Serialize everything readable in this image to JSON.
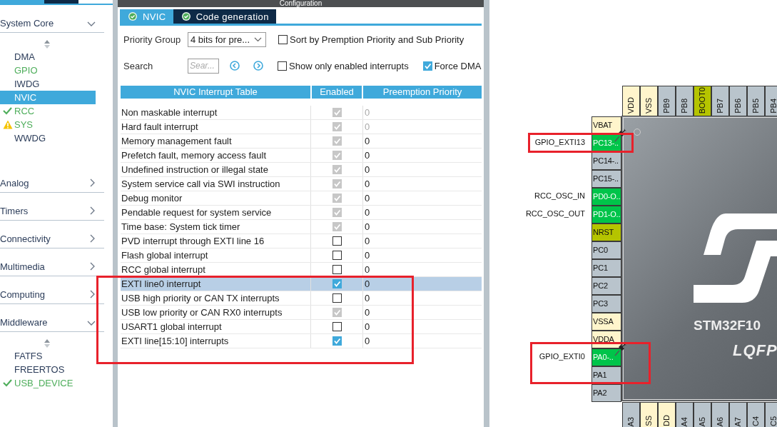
{
  "sidebar": {
    "top_tabs": [
      {
        "selected": true
      },
      {
        "selected": false
      }
    ],
    "categories": [
      {
        "label": "System Core",
        "expanded": true,
        "items": [
          {
            "label": "DMA",
            "kind": "plain",
            "selected": false
          },
          {
            "label": "GPIO",
            "kind": "configured",
            "selected": false
          },
          {
            "label": "IWDG",
            "kind": "plain",
            "selected": false
          },
          {
            "label": "NVIC",
            "kind": "plain",
            "selected": true
          },
          {
            "label": "RCC",
            "kind": "ok",
            "selected": false
          },
          {
            "label": "SYS",
            "kind": "warning",
            "selected": false
          },
          {
            "label": "WWDG",
            "kind": "plain",
            "selected": false
          }
        ]
      },
      {
        "label": "Analog",
        "expanded": false
      },
      {
        "label": "Timers",
        "expanded": false
      },
      {
        "label": "Connectivity",
        "expanded": false
      },
      {
        "label": "Multimedia",
        "expanded": false
      },
      {
        "label": "Computing",
        "expanded": false
      },
      {
        "label": "Middleware",
        "expanded": true,
        "items": [
          {
            "label": "FATFS",
            "kind": "plain",
            "selected": false
          },
          {
            "label": "FREERTOS",
            "kind": "plain",
            "selected": false
          },
          {
            "label": "USB_DEVICE",
            "kind": "ok",
            "selected": false
          }
        ]
      }
    ]
  },
  "panel": {
    "title": "Configuration",
    "tabs": [
      {
        "label": "NVIC",
        "selected": true
      },
      {
        "label": "Code generation",
        "selected": false
      }
    ],
    "priority_group": {
      "label": "Priority Group",
      "value": "4 bits for pre..."
    },
    "sort_option": {
      "label": "Sort by Premption Priority and Sub Priority",
      "checked": false
    },
    "search": {
      "label": "Search",
      "placeholder": "Sear..."
    },
    "show_enabled_option": {
      "label": "Show only enabled interrupts",
      "checked": false
    },
    "force_dma_option": {
      "label": "Force DMA",
      "checked": true
    },
    "table": {
      "columns": [
        "NVIC Interrupt Table",
        "Enabled",
        "Preemption Priority"
      ],
      "rows": [
        {
          "name": "Non maskable interrupt",
          "enabled": true,
          "editable": false,
          "priority": "0",
          "priority_editable": false,
          "selected": false
        },
        {
          "name": "Hard fault interrupt",
          "enabled": true,
          "editable": false,
          "priority": "0",
          "priority_editable": false,
          "selected": false
        },
        {
          "name": "Memory management fault",
          "enabled": true,
          "editable": false,
          "priority": "0",
          "priority_editable": true,
          "selected": false
        },
        {
          "name": "Prefetch fault, memory access fault",
          "enabled": true,
          "editable": false,
          "priority": "0",
          "priority_editable": true,
          "selected": false
        },
        {
          "name": "Undefined instruction or illegal state",
          "enabled": true,
          "editable": false,
          "priority": "0",
          "priority_editable": true,
          "selected": false
        },
        {
          "name": "System service call via SWI instruction",
          "enabled": true,
          "editable": false,
          "priority": "0",
          "priority_editable": true,
          "selected": false
        },
        {
          "name": "Debug monitor",
          "enabled": true,
          "editable": false,
          "priority": "0",
          "priority_editable": true,
          "selected": false
        },
        {
          "name": "Pendable request for system service",
          "enabled": true,
          "editable": false,
          "priority": "0",
          "priority_editable": true,
          "selected": false
        },
        {
          "name": "Time base: System tick timer",
          "enabled": true,
          "editable": false,
          "priority": "0",
          "priority_editable": true,
          "selected": false
        },
        {
          "name": "PVD interrupt through EXTI line 16",
          "enabled": false,
          "editable": true,
          "priority": "0",
          "priority_editable": true,
          "selected": false
        },
        {
          "name": "Flash global interrupt",
          "enabled": false,
          "editable": true,
          "priority": "0",
          "priority_editable": true,
          "selected": false
        },
        {
          "name": "RCC global interrupt",
          "enabled": false,
          "editable": true,
          "priority": "0",
          "priority_editable": true,
          "selected": false
        },
        {
          "name": "EXTI line0 interrupt",
          "enabled": true,
          "editable": true,
          "priority": "0",
          "priority_editable": true,
          "selected": true
        },
        {
          "name": "USB high priority or CAN TX interrupts",
          "enabled": false,
          "editable": true,
          "priority": "0",
          "priority_editable": true,
          "selected": false
        },
        {
          "name": "USB low priority or CAN RX0 interrupts",
          "enabled": true,
          "editable": false,
          "priority": "0",
          "priority_editable": true,
          "selected": false
        },
        {
          "name": "USART1 global interrupt",
          "enabled": false,
          "editable": true,
          "priority": "0",
          "priority_editable": true,
          "selected": false
        },
        {
          "name": "EXTI line[15:10] interrupts",
          "enabled": true,
          "editable": true,
          "priority": "0",
          "priority_editable": true,
          "selected": false
        }
      ]
    }
  },
  "chip": {
    "name": "STM32F10",
    "package": "LQFP",
    "top_pins": [
      {
        "label": "VDD",
        "kind": "power"
      },
      {
        "label": "VSS",
        "kind": "power"
      },
      {
        "label": "PB9",
        "kind": "io"
      },
      {
        "label": "PB8",
        "kind": "io"
      },
      {
        "label": "BOOT0",
        "kind": "special"
      },
      {
        "label": "PB7",
        "kind": "io"
      },
      {
        "label": "PB6",
        "kind": "io"
      },
      {
        "label": "PB5",
        "kind": "io"
      },
      {
        "label": "PB4",
        "kind": "io"
      }
    ],
    "left_pins": [
      {
        "label": "VBAT",
        "kind": "power",
        "pinned": false
      },
      {
        "label": "PC13-..",
        "kind": "assigned",
        "signal": "GPIO_EXTI13",
        "pinned": true
      },
      {
        "label": "PC14-..",
        "kind": "io",
        "pinned": false
      },
      {
        "label": "PC15-..",
        "kind": "io",
        "pinned": false
      },
      {
        "label": "PD0-O..",
        "kind": "assigned",
        "signal": "RCC_OSC_IN",
        "pinned": false
      },
      {
        "label": "PD1-O..",
        "kind": "assigned",
        "signal": "RCC_OSC_OUT",
        "pinned": false
      },
      {
        "label": "NRST",
        "kind": "special",
        "pinned": false
      },
      {
        "label": "PC0",
        "kind": "io",
        "pinned": false
      },
      {
        "label": "PC1",
        "kind": "io",
        "pinned": false
      },
      {
        "label": "PC2",
        "kind": "io",
        "pinned": false
      },
      {
        "label": "PC3",
        "kind": "io",
        "pinned": false
      },
      {
        "label": "VSSA",
        "kind": "power",
        "pinned": false
      },
      {
        "label": "VDDA",
        "kind": "power",
        "pinned": false
      },
      {
        "label": "PA0-..",
        "kind": "assigned",
        "signal": "GPIO_EXTI0",
        "pinned": true
      },
      {
        "label": "PA1",
        "kind": "io",
        "pinned": false
      },
      {
        "label": "PA2",
        "kind": "io",
        "pinned": false
      }
    ],
    "bottom_pins": [
      {
        "label": "A3",
        "kind": "io"
      },
      {
        "label": "SS",
        "kind": "power"
      },
      {
        "label": "DD",
        "kind": "power"
      },
      {
        "label": "A4",
        "kind": "io"
      },
      {
        "label": "A5",
        "kind": "io"
      },
      {
        "label": "A6",
        "kind": "io"
      },
      {
        "label": "A7",
        "kind": "io"
      },
      {
        "label": "C4",
        "kind": "io"
      },
      {
        "label": "C5",
        "kind": "io"
      }
    ]
  }
}
